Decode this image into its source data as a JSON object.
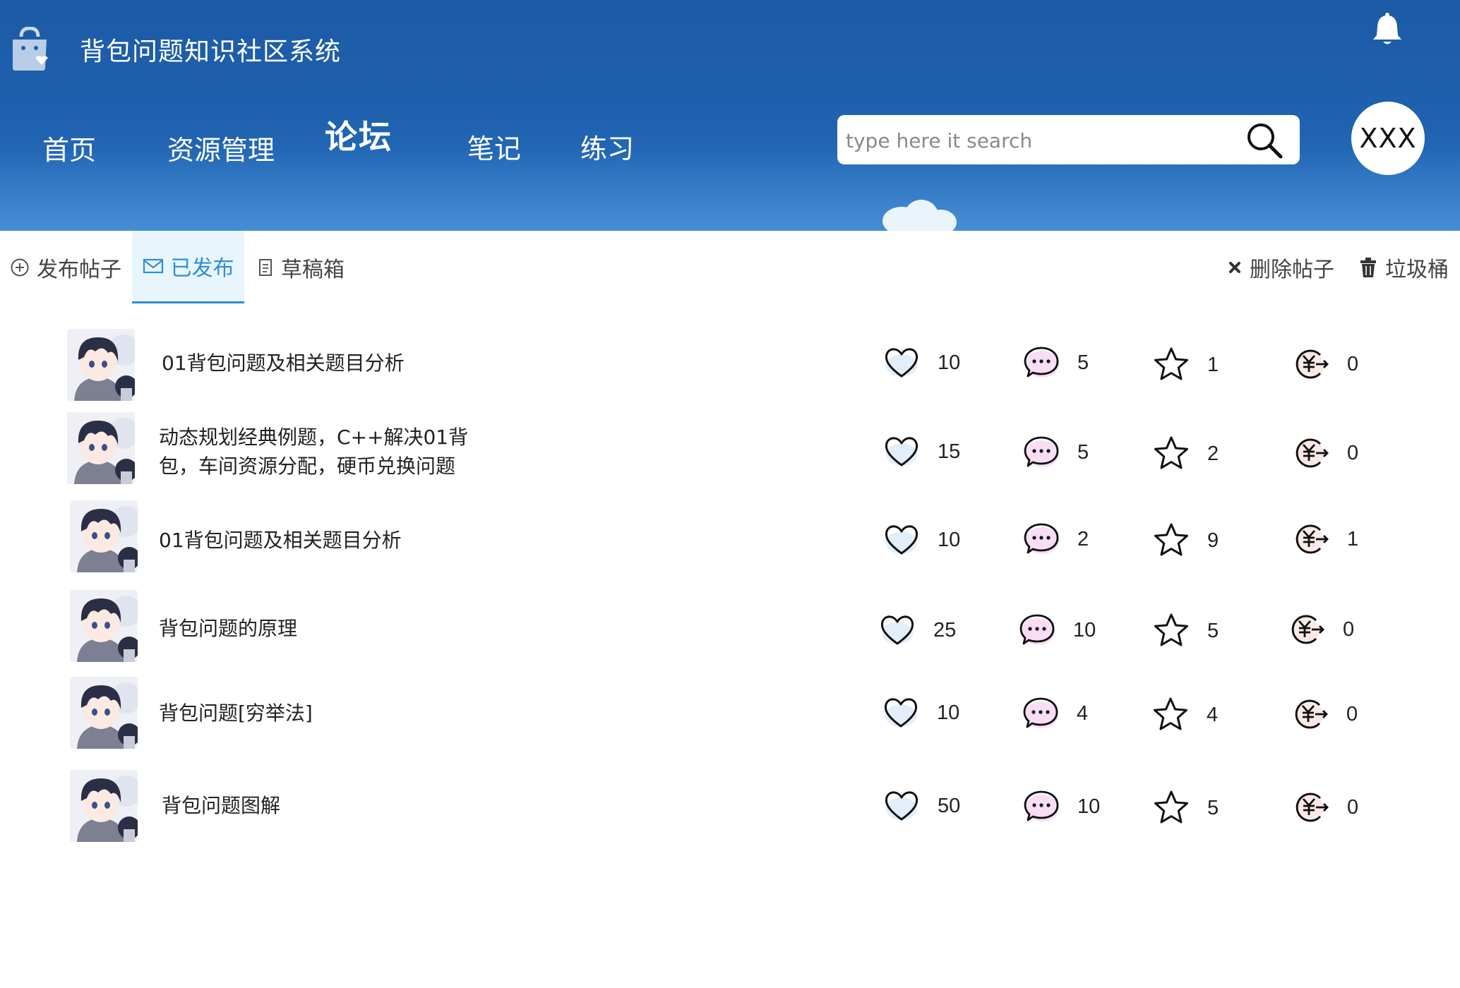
{
  "app": {
    "title": "背包问题知识社区系统"
  },
  "nav": {
    "items": [
      {
        "label": "首页",
        "active": false
      },
      {
        "label": "资源管理",
        "active": false
      },
      {
        "label": "论坛",
        "active": true
      },
      {
        "label": "笔记",
        "active": false
      },
      {
        "label": "练习",
        "active": false
      }
    ]
  },
  "search": {
    "placeholder": "type here it search",
    "value": ""
  },
  "user": {
    "name": "XXX"
  },
  "toolbar": {
    "tabs": [
      {
        "label": "发布帖子",
        "icon": "plus-circle-icon",
        "selected": false
      },
      {
        "label": "已发布",
        "icon": "mail-icon",
        "selected": true
      },
      {
        "label": "草稿箱",
        "icon": "document-icon",
        "selected": false
      }
    ],
    "actions": [
      {
        "label": "删除帖子",
        "icon": "close-icon"
      },
      {
        "label": "垃圾桶",
        "icon": "trash-icon"
      }
    ]
  },
  "posts": [
    {
      "title": "01背包问题及相关题目分析",
      "likes": "10",
      "comments": "5",
      "stars": "1",
      "coins": "0"
    },
    {
      "title": "动态规划经典例题，C++解决01背包，车间资源分配，硬币兑换问题",
      "likes": "15",
      "comments": "5",
      "stars": "2",
      "coins": "0"
    },
    {
      "title": "01背包问题及相关题目分析",
      "likes": "10",
      "comments": "2",
      "stars": "9",
      "coins": "1"
    },
    {
      "title": "背包问题的原理",
      "likes": "25",
      "comments": "10",
      "stars": "5",
      "coins": "0"
    },
    {
      "title": "背包问题[穷举法]",
      "likes": "10",
      "comments": "4",
      "stars": "4",
      "coins": "0"
    },
    {
      "title": "背包问题图解",
      "likes": "50",
      "comments": "10",
      "stars": "5",
      "coins": "0"
    }
  ],
  "colors": {
    "header": "#1f5fae",
    "tab_active_text": "#2e8fd6",
    "tab_active_bg": "#e9f5fd",
    "comment_glow": "#f3c6ef",
    "like_glow": "#cfe3f7",
    "coin_glow": "#f6d7d2"
  }
}
